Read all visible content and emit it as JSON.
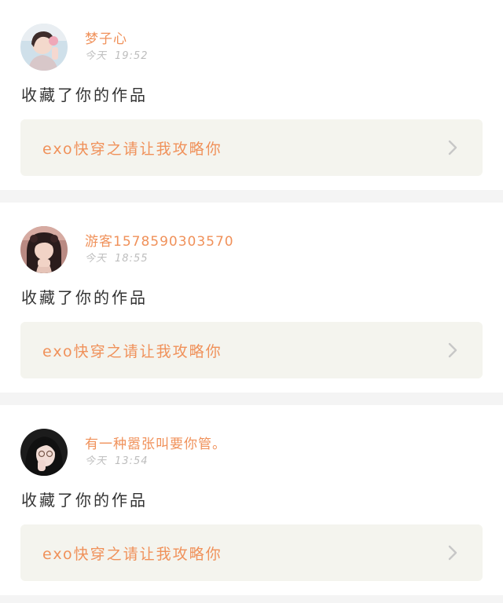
{
  "notifications": [
    {
      "username": "梦子心",
      "day": "今天",
      "time": "19:52",
      "action": "收藏了你的作品",
      "work_title": "exo快穿之请让我攻略你",
      "avatar_icon": "avatar-girl-light-icon"
    },
    {
      "username": "游客1578590303570",
      "day": "今天",
      "time": "18:55",
      "action": "收藏了你的作品",
      "work_title": "exo快穿之请让我攻略你",
      "avatar_icon": "avatar-girl-pink-icon"
    },
    {
      "username": "有一种嚣张叫要你管。",
      "day": "今天",
      "time": "13:54",
      "action": "收藏了你的作品",
      "work_title": "exo快穿之请让我攻略你",
      "avatar_icon": "avatar-girl-dark-icon"
    }
  ],
  "colors": {
    "accent": "#f0915a",
    "text": "#333333",
    "muted": "#bdbdbd",
    "work_bg": "#f4f4ee",
    "page_bg": "#f4f4f4"
  }
}
